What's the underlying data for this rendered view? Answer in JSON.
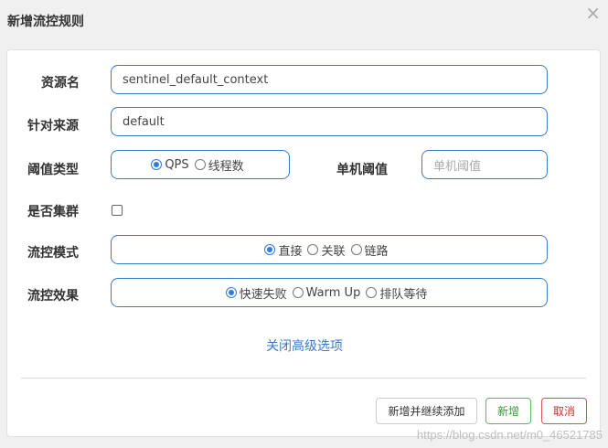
{
  "dialog": {
    "title": "新增流控规则",
    "close_glyph": "×"
  },
  "form": {
    "resource": {
      "label": "资源名",
      "value": "sentinel_default_context"
    },
    "origin": {
      "label": "针对来源",
      "value": "default"
    },
    "threshold_type": {
      "label": "阈值类型",
      "options": [
        "QPS",
        "线程数"
      ],
      "selected": "QPS"
    },
    "single_threshold": {
      "label": "单机阈值",
      "placeholder": "单机阈值"
    },
    "cluster": {
      "label": "是否集群",
      "checked": false
    },
    "flow_mode": {
      "label": "流控模式",
      "options": [
        "直接",
        "关联",
        "链路"
      ],
      "selected": "直接"
    },
    "flow_effect": {
      "label": "流控效果",
      "options": [
        "快速失败",
        "Warm Up",
        "排队等待"
      ],
      "selected": "快速失败"
    },
    "advanced_link": "关闭高级选项"
  },
  "buttons": {
    "add_continue": "新增并继续添加",
    "add": "新增",
    "cancel": "取消"
  },
  "watermark": "https://blog.csdn.net/m0_46521785",
  "colors": {
    "accent": "#3a79c5",
    "success": "#5cb85c",
    "danger": "#d9534f"
  }
}
